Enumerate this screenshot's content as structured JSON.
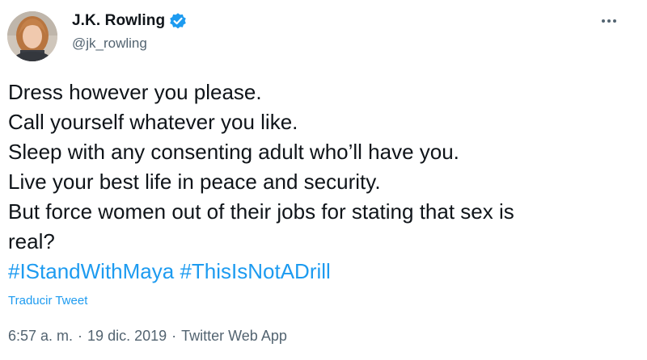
{
  "author": {
    "display_name": "J.K. Rowling",
    "handle": "@jk_rowling",
    "verified": true,
    "verified_color": "#1d9bf0"
  },
  "tweet": {
    "lines": [
      "Dress however you please.",
      "Call yourself whatever you like.",
      "Sleep with any consenting adult who’ll have you.",
      "Live your best life in peace and security.",
      "But force women out of their jobs for stating that sex is",
      "real?"
    ],
    "hashtags": [
      "#IStandWithMaya",
      "#ThisIsNotADrill"
    ],
    "translate_label": "Traducir Tweet"
  },
  "meta": {
    "time": "6:57 a. m.",
    "date": "19 dic. 2019",
    "source": "Twitter Web App",
    "separator": "·"
  },
  "icons": {
    "more": "more-options-icon",
    "verified": "verified-badge-icon"
  },
  "colors": {
    "text": "#0f1419",
    "secondary": "#536471",
    "link": "#1d9bf0"
  }
}
